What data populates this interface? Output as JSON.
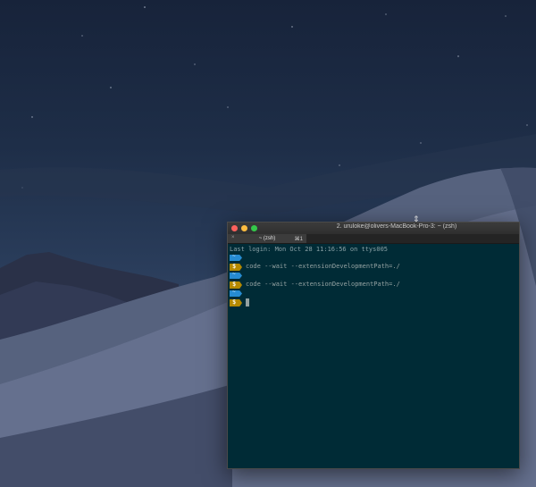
{
  "window": {
    "title": "2. uruloke@olivers-MacBook-Pro-3: ~ (zsh)",
    "tab_close": "×",
    "tab_label": "~ (zsh)",
    "tab_shortcut": "⌘1"
  },
  "terminal": {
    "last_login": "Last login: Mon Oct 28 11:16:56 on ttys005",
    "dir_symbol": "~",
    "prompt_symbol": "$",
    "commands": [
      "code --wait --extensionDevelopmentPath=./",
      "code --wait --extensionDevelopmentPath=./"
    ]
  },
  "colors": {
    "terminal_bg": "#002b36",
    "dir_pill": "#268bd2",
    "prompt_pill": "#b58900"
  },
  "icons": {
    "resize_cursor": "resize-cursor-icon"
  }
}
